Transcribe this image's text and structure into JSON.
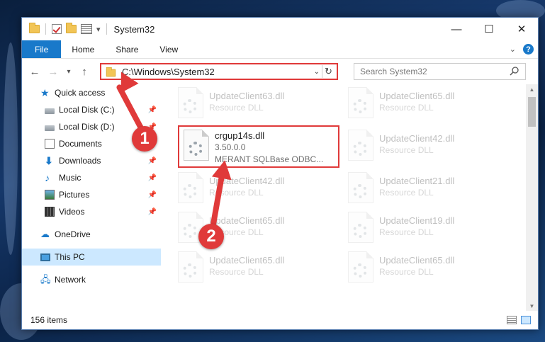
{
  "window": {
    "title": "System32"
  },
  "ribbon": {
    "tabs": [
      "File",
      "Home",
      "Share",
      "View"
    ],
    "help": "?"
  },
  "navigation": {
    "address": "C:\\Windows\\System32",
    "search_placeholder": "Search System32"
  },
  "sidebar": {
    "items": [
      {
        "label": "Quick access",
        "icon": "quick-access-star-icon"
      },
      {
        "label": "Local Disk (C:)",
        "icon": "disk-icon",
        "pinned": true
      },
      {
        "label": "Local Disk (D:)",
        "icon": "disk-icon",
        "pinned": true
      },
      {
        "label": "Documents",
        "icon": "documents-icon",
        "pinned": true
      },
      {
        "label": "Downloads",
        "icon": "downloads-icon",
        "pinned": true
      },
      {
        "label": "Music",
        "icon": "music-icon",
        "pinned": true
      },
      {
        "label": "Pictures",
        "icon": "pictures-icon",
        "pinned": true
      },
      {
        "label": "Videos",
        "icon": "videos-icon",
        "pinned": true
      },
      {
        "label": "OneDrive",
        "icon": "onedrive-icon"
      },
      {
        "label": "This PC",
        "icon": "this-pc-icon",
        "selected": true
      },
      {
        "label": "Network",
        "icon": "network-icon"
      }
    ]
  },
  "files": {
    "left_column": [
      {
        "name": "UpdateClient63.dll",
        "desc": "Resource DLL",
        "faded": true
      },
      {
        "name": "crgup14s.dll",
        "version": "3.50.0.0",
        "desc": "MERANT SQLBase ODBC...",
        "highlighted": true
      },
      {
        "name": "UpdateClient42.dll",
        "desc": "Resource DLL",
        "faded": true
      },
      {
        "name": "UpdateClient65.dll",
        "desc": "Resource DLL",
        "faded": true
      },
      {
        "name": "UpdateClient65.dll",
        "desc": "Resource DLL",
        "faded": true
      }
    ],
    "right_column": [
      {
        "name": "UpdateClient65.dll",
        "desc": "Resource DLL",
        "faded": true
      },
      {
        "name": "UpdateClient42.dll",
        "desc": "Resource DLL",
        "faded": true
      },
      {
        "name": "UpdateClient21.dll",
        "desc": "Resource DLL",
        "faded": true
      },
      {
        "name": "UpdateClient19.dll",
        "desc": "Resource DLL",
        "faded": true
      },
      {
        "name": "UpdateClient65.dll",
        "desc": "Resource DLL",
        "faded": true
      }
    ]
  },
  "status": {
    "item_count": "156 items"
  },
  "annotations": {
    "step1": "1",
    "step2": "2",
    "color": "#e03a3a"
  }
}
